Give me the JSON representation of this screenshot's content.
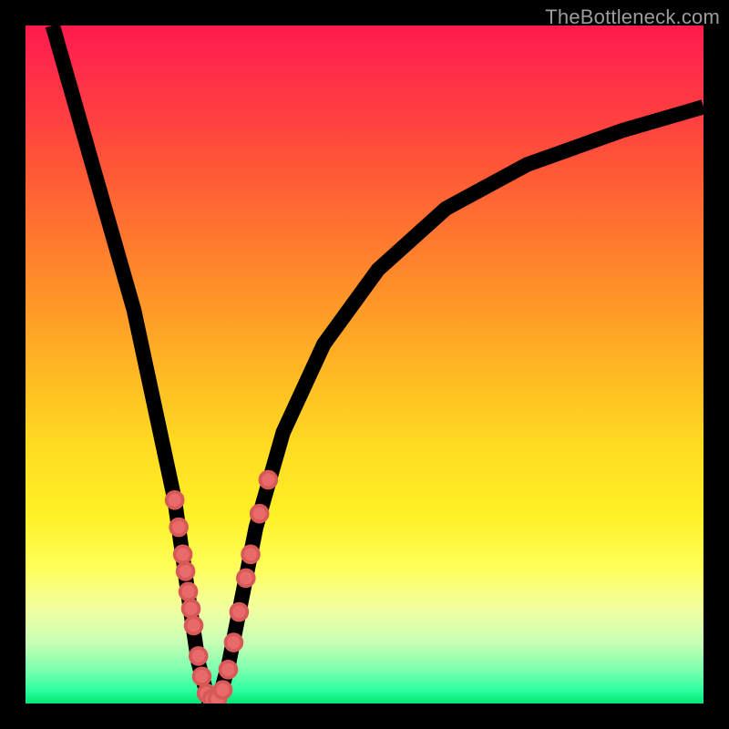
{
  "watermark": "TheBottleneck.com",
  "colors": {
    "frame": "#000000",
    "curve": "#000000",
    "dot_fill": "#e86a6a",
    "dot_stroke": "#d85858",
    "gradient_top": "#ff1a4d",
    "gradient_bottom": "#00e676"
  },
  "chart_data": {
    "type": "line",
    "title": "",
    "xlabel": "",
    "ylabel": "",
    "xlim": [
      0,
      100
    ],
    "ylim": [
      0,
      100
    ],
    "grid": false,
    "series": [
      {
        "name": "bottleneck-curve",
        "x": [
          4,
          8,
          12,
          16,
          19,
          22,
          24,
          25.5,
          27,
          28.5,
          30,
          32,
          34,
          38,
          44,
          52,
          62,
          74,
          88,
          100
        ],
        "values": [
          100,
          86,
          72,
          58,
          44,
          30,
          16,
          6,
          0.5,
          0.5,
          6,
          16,
          26,
          40,
          53,
          64,
          73,
          79.5,
          84.5,
          88
        ]
      }
    ],
    "points": [
      {
        "x": 22.0,
        "y": 30.0
      },
      {
        "x": 22.6,
        "y": 26.0
      },
      {
        "x": 23.2,
        "y": 22.0
      },
      {
        "x": 23.6,
        "y": 19.5
      },
      {
        "x": 24.0,
        "y": 16.5
      },
      {
        "x": 24.4,
        "y": 14.0
      },
      {
        "x": 24.8,
        "y": 11.5
      },
      {
        "x": 25.5,
        "y": 7.0
      },
      {
        "x": 26.0,
        "y": 4.0
      },
      {
        "x": 26.7,
        "y": 1.5
      },
      {
        "x": 27.5,
        "y": 0.7
      },
      {
        "x": 28.3,
        "y": 0.7
      },
      {
        "x": 29.1,
        "y": 2.0
      },
      {
        "x": 29.9,
        "y": 5.0
      },
      {
        "x": 30.7,
        "y": 9.0
      },
      {
        "x": 31.5,
        "y": 13.5
      },
      {
        "x": 32.5,
        "y": 18.5
      },
      {
        "x": 33.2,
        "y": 22.0
      },
      {
        "x": 34.5,
        "y": 28.0
      },
      {
        "x": 35.8,
        "y": 33.0
      }
    ],
    "point_radius": 1.2
  }
}
